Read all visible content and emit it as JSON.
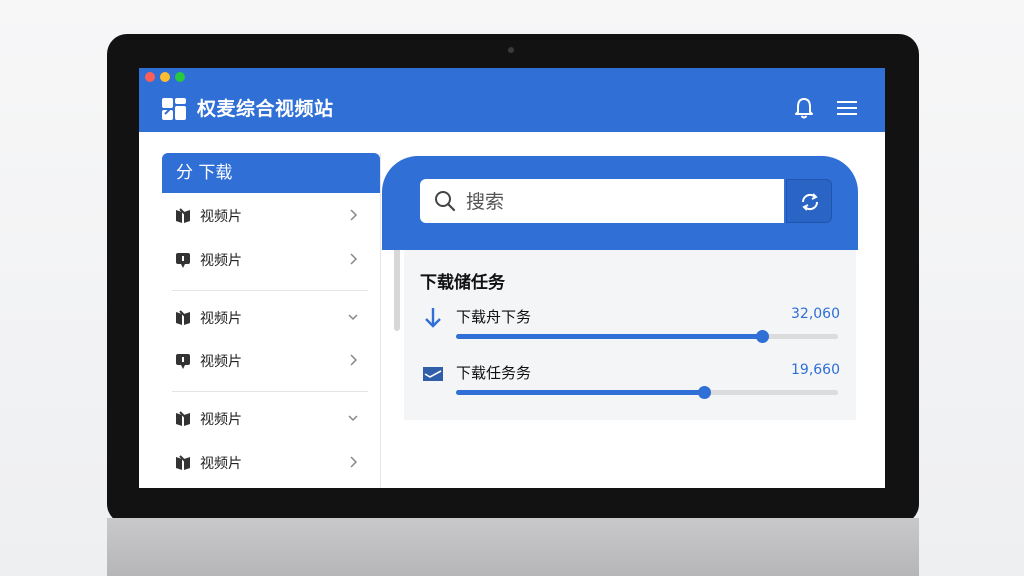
{
  "app": {
    "title": "权麦综合视频站"
  },
  "sidebar": {
    "header": "分 下载",
    "items": [
      {
        "label": "视频片",
        "icon": "book-icon",
        "chevron": "right"
      },
      {
        "label": "视频片",
        "icon": "chat-icon",
        "chevron": "right"
      },
      {
        "label": "视频片",
        "icon": "book-icon",
        "chevron": "down"
      },
      {
        "label": "视频片",
        "icon": "chat-icon",
        "chevron": "right"
      },
      {
        "label": "视频片",
        "icon": "book-icon",
        "chevron": "down"
      },
      {
        "label": "视频片",
        "icon": "book-icon",
        "chevron": "right"
      }
    ]
  },
  "search": {
    "placeholder": "搜索"
  },
  "tasks": {
    "title": "下载储任务",
    "items": [
      {
        "label": "下载舟下务",
        "value": "32,060",
        "progress": 0.8,
        "icon": "download-arrow-icon"
      },
      {
        "label": "下载任务务",
        "value": "19,660",
        "progress": 0.65,
        "icon": "envelope-icon"
      }
    ]
  },
  "colors": {
    "accent": "#2f6fd6",
    "bezel": "#121212"
  }
}
